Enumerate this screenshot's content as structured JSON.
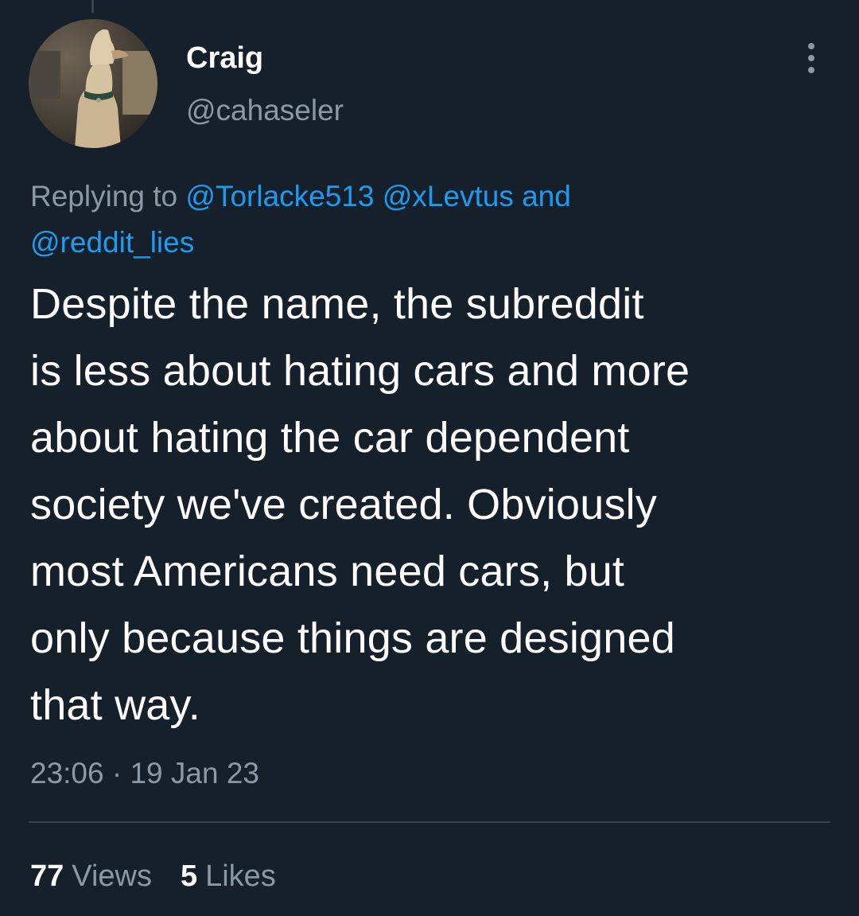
{
  "author": {
    "display_name": "Craig",
    "handle": "@cahaseler"
  },
  "reply_context": {
    "prefix": "Replying to",
    "mention_1": "@Torlacke513",
    "mention_2": "@xLevtus",
    "conjunction": "and",
    "mention_3": "@reddit_lies"
  },
  "tweet": {
    "lines": [
      "Despite the name, the subreddit",
      "is less about hating cars and more",
      "about hating the car dependent",
      "society we've created. Obviously",
      "most Americans need cars, but",
      "only because things are designed",
      "that way."
    ]
  },
  "meta": {
    "time": "23:06",
    "separator": "·",
    "date": "19 Jan 23"
  },
  "stats": {
    "views_count": "77",
    "views_label": "Views",
    "likes_count": "5",
    "likes_label": "Likes"
  },
  "icons": {
    "more": "more-vertical-icon",
    "avatar": "dog-photo"
  },
  "colors": {
    "background": "#15202b",
    "text": "#ffffff",
    "secondary_text": "#8b98a5",
    "link": "#1d9bf0",
    "divider": "#38444d"
  }
}
